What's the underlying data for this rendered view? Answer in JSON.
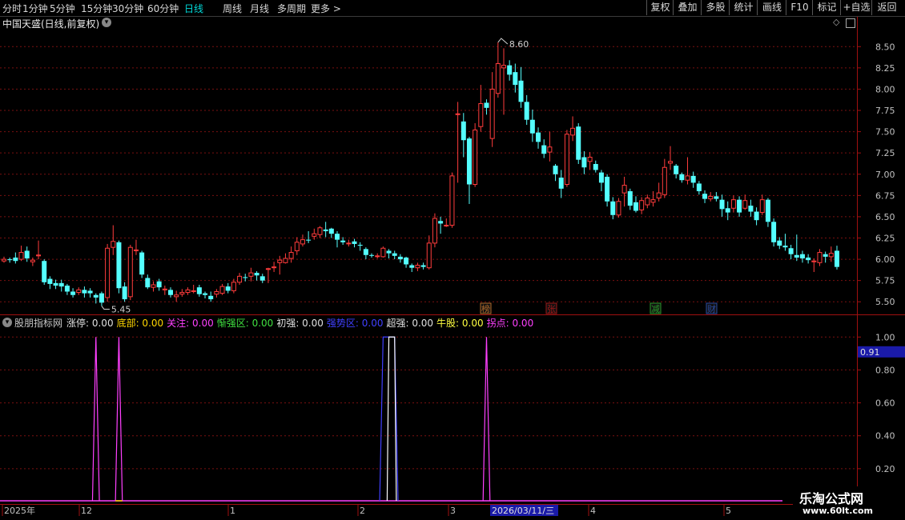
{
  "toolbar": {
    "periods": [
      "分时",
      "1分钟",
      "5分钟",
      "15分钟",
      "30分钟",
      "60分钟",
      "日线",
      "周线",
      "月线",
      "多周期",
      "更多 >"
    ],
    "active_period": "日线",
    "right_buttons": [
      "复权",
      "叠加",
      "多股",
      "统计",
      "画线",
      "F10",
      "标记",
      "+自选",
      "返回"
    ]
  },
  "main_chart": {
    "title": "中国天盛(日线,前复权)",
    "y_ticks": [
      "8.50",
      "8.25",
      "8.00",
      "7.75",
      "7.50",
      "7.25",
      "7.00",
      "6.75",
      "6.50",
      "6.25",
      "6.00",
      "5.75",
      "5.50"
    ],
    "high_label": "8.60",
    "low_label": "5.45",
    "event_badges": [
      {
        "label": "榜",
        "color": "#b06a2a"
      },
      {
        "label": "张",
        "color": "#a01818"
      },
      {
        "label": "减",
        "color": "#2a9a2a"
      },
      {
        "label": "财",
        "color": "#2a4aa0"
      }
    ]
  },
  "indicator": {
    "name": "股朋指标网",
    "items": [
      {
        "label": "涨停: 0.00",
        "color": "#e0e0e0"
      },
      {
        "label": "底部: 0.00",
        "color": "#ffd700"
      },
      {
        "label": "关注: 0.00",
        "color": "#ff40ff"
      },
      {
        "label": "惭强区: 0.00",
        "color": "#40e040"
      },
      {
        "label": "初强: 0.00",
        "color": "#e0e0e0"
      },
      {
        "label": "强势区: 0.00",
        "color": "#4040ff"
      },
      {
        "label": "超强: 0.00",
        "color": "#e0e0e0"
      },
      {
        "label": "牛股: 0.00",
        "color": "#ffff40"
      },
      {
        "label": "拐点: 0.00",
        "color": "#ff40ff"
      }
    ],
    "y_ticks": [
      "1.00",
      "0.80",
      "0.60",
      "0.40",
      "0.20"
    ],
    "current_value": "0.91"
  },
  "x_axis": {
    "labels": [
      "2025年",
      "12",
      "1",
      "2",
      "3",
      "4",
      "5"
    ],
    "highlight_date": "2026/03/11/三"
  },
  "watermark": {
    "line1": "乐淘公式网",
    "line2": "www.60lt.com"
  },
  "colors": {
    "up": "#ff3c3c",
    "down": "#54ffff",
    "grid": "#7a1010",
    "axis_text": "#c0c0c0"
  },
  "chart_data": {
    "type": "candlestick",
    "ylim": [
      5.38,
      8.7
    ],
    "indicator_ylim": [
      0,
      1.05
    ],
    "candles": [
      [
        5.98,
        6.0,
        5.96,
        6.03
      ],
      [
        6.0,
        5.99,
        5.96,
        6.02
      ],
      [
        6.02,
        5.98,
        5.95,
        6.08
      ],
      [
        6.0,
        6.08,
        5.98,
        6.16
      ],
      [
        6.1,
        6.01,
        5.97,
        6.15
      ],
      [
        5.97,
        5.99,
        5.92,
        6.02
      ],
      [
        6.04,
        6.05,
        6.0,
        6.22
      ],
      [
        5.98,
        5.73,
        5.7,
        6.0
      ],
      [
        5.77,
        5.71,
        5.65,
        5.8
      ],
      [
        5.72,
        5.69,
        5.65,
        5.76
      ],
      [
        5.72,
        5.68,
        5.62,
        5.76
      ],
      [
        5.69,
        5.62,
        5.58,
        5.71
      ],
      [
        5.62,
        5.58,
        5.55,
        5.66
      ],
      [
        5.61,
        5.64,
        5.58,
        5.67
      ],
      [
        5.64,
        5.6,
        5.55,
        5.68
      ],
      [
        5.63,
        5.6,
        5.55,
        5.66
      ],
      [
        5.58,
        5.55,
        5.48,
        5.6
      ],
      [
        5.6,
        5.49,
        5.45,
        5.62
      ],
      [
        5.55,
        6.13,
        5.5,
        6.18
      ],
      [
        6.14,
        6.21,
        6.05,
        6.4
      ],
      [
        6.2,
        5.66,
        5.6,
        6.22
      ],
      [
        5.68,
        5.53,
        5.5,
        5.73
      ],
      [
        5.56,
        6.14,
        5.52,
        6.17
      ],
      [
        6.1,
        6.11,
        6.05,
        6.23
      ],
      [
        6.08,
        5.82,
        5.78,
        6.1
      ],
      [
        5.78,
        5.67,
        5.65,
        5.82
      ],
      [
        5.67,
        5.7,
        5.62,
        5.74
      ],
      [
        5.74,
        5.67,
        5.63,
        5.77
      ],
      [
        5.64,
        5.65,
        5.58,
        5.69
      ],
      [
        5.64,
        5.58,
        5.55,
        5.67
      ],
      [
        5.56,
        5.58,
        5.5,
        5.63
      ],
      [
        5.59,
        5.61,
        5.56,
        5.65
      ],
      [
        5.61,
        5.64,
        5.58,
        5.67
      ],
      [
        5.62,
        5.63,
        5.6,
        5.7
      ],
      [
        5.67,
        5.59,
        5.56,
        5.7
      ],
      [
        5.6,
        5.58,
        5.54,
        5.62
      ],
      [
        5.57,
        5.53,
        5.5,
        5.62
      ],
      [
        5.59,
        5.62,
        5.55,
        5.65
      ],
      [
        5.6,
        5.68,
        5.58,
        5.71
      ],
      [
        5.68,
        5.63,
        5.6,
        5.72
      ],
      [
        5.63,
        5.73,
        5.6,
        5.77
      ],
      [
        5.73,
        5.8,
        5.7,
        5.84
      ],
      [
        5.79,
        5.78,
        5.74,
        5.83
      ],
      [
        5.8,
        5.84,
        5.74,
        5.9
      ],
      [
        5.84,
        5.81,
        5.75,
        5.86
      ],
      [
        5.8,
        5.75,
        5.72,
        5.83
      ],
      [
        5.88,
        5.89,
        5.72,
        5.9
      ],
      [
        5.9,
        5.91,
        5.85,
        5.97
      ],
      [
        5.96,
        5.99,
        5.82,
        6.04
      ],
      [
        5.96,
        6.01,
        5.95,
        6.07
      ],
      [
        6.01,
        6.08,
        5.96,
        6.15
      ],
      [
        6.1,
        6.2,
        6.05,
        6.26
      ],
      [
        6.18,
        6.23,
        6.15,
        6.29
      ],
      [
        6.23,
        6.22,
        6.19,
        6.33
      ],
      [
        6.27,
        6.3,
        6.23,
        6.36
      ],
      [
        6.29,
        6.37,
        6.25,
        6.39
      ],
      [
        6.35,
        6.33,
        6.26,
        6.44
      ],
      [
        6.36,
        6.3,
        6.25,
        6.37
      ],
      [
        6.3,
        6.23,
        6.14,
        6.33
      ],
      [
        6.22,
        6.2,
        6.17,
        6.26
      ],
      [
        6.19,
        6.19,
        6.15,
        6.23
      ],
      [
        6.21,
        6.18,
        6.14,
        6.24
      ],
      [
        6.17,
        6.16,
        6.1,
        6.2
      ],
      [
        6.12,
        6.05,
        6.0,
        6.14
      ],
      [
        6.05,
        6.04,
        6.02,
        6.07
      ],
      [
        6.04,
        6.04,
        6.01,
        6.07
      ],
      [
        6.03,
        6.13,
        6.02,
        6.15
      ],
      [
        6.1,
        6.07,
        6.01,
        6.12
      ],
      [
        6.07,
        6.04,
        6.0,
        6.1
      ],
      [
        6.03,
        6.0,
        5.96,
        6.06
      ],
      [
        6.02,
        5.94,
        5.9,
        6.03
      ],
      [
        5.93,
        5.9,
        5.85,
        5.95
      ],
      [
        5.9,
        5.93,
        5.86,
        5.96
      ],
      [
        5.93,
        5.91,
        5.88,
        5.96
      ],
      [
        5.9,
        6.19,
        5.88,
        6.28
      ],
      [
        6.19,
        6.48,
        6.14,
        6.54
      ],
      [
        6.45,
        6.42,
        6.3,
        6.5
      ],
      [
        6.4,
        6.4,
        6.38,
        6.48
      ],
      [
        6.4,
        6.98,
        6.37,
        7.02
      ],
      [
        7.71,
        7.71,
        6.9,
        7.85
      ],
      [
        7.62,
        7.4,
        7.2,
        7.72
      ],
      [
        7.42,
        6.88,
        6.65,
        7.44
      ],
      [
        6.88,
        7.52,
        6.85,
        7.6
      ],
      [
        7.56,
        7.83,
        7.5,
        8.05
      ],
      [
        7.84,
        7.78,
        7.7,
        7.88
      ],
      [
        7.42,
        8.0,
        7.32,
        8.2
      ],
      [
        7.95,
        8.3,
        7.9,
        8.55
      ],
      [
        8.25,
        8.28,
        7.7,
        8.48
      ],
      [
        8.28,
        8.17,
        8.1,
        8.34
      ],
      [
        8.2,
        8.05,
        7.96,
        8.3
      ],
      [
        8.1,
        7.85,
        7.78,
        8.26
      ],
      [
        7.85,
        7.64,
        7.58,
        7.93
      ],
      [
        7.64,
        7.48,
        7.38,
        7.76
      ],
      [
        7.49,
        7.38,
        7.3,
        7.55
      ],
      [
        7.34,
        7.24,
        7.19,
        7.41
      ],
      [
        7.26,
        7.32,
        7.15,
        7.5
      ],
      [
        7.1,
        7.0,
        6.92,
        7.12
      ],
      [
        6.96,
        6.83,
        6.72,
        7.05
      ],
      [
        6.88,
        7.47,
        6.85,
        7.52
      ],
      [
        7.46,
        7.54,
        7.39,
        7.68
      ],
      [
        7.56,
        7.17,
        7.12,
        7.6
      ],
      [
        7.2,
        7.08,
        7.0,
        7.27
      ],
      [
        7.15,
        7.2,
        7.05,
        7.26
      ],
      [
        7.12,
        7.05,
        7.02,
        7.16
      ],
      [
        7.02,
        6.9,
        6.8,
        7.05
      ],
      [
        6.97,
        6.68,
        6.62,
        7.0
      ],
      [
        6.68,
        6.52,
        6.47,
        6.73
      ],
      [
        6.52,
        6.68,
        6.49,
        6.72
      ],
      [
        6.78,
        6.87,
        6.62,
        6.97
      ],
      [
        6.8,
        6.63,
        6.58,
        6.83
      ],
      [
        6.67,
        6.57,
        6.55,
        6.74
      ],
      [
        6.58,
        6.69,
        6.53,
        6.73
      ],
      [
        6.64,
        6.72,
        6.6,
        6.76
      ],
      [
        6.67,
        6.7,
        6.62,
        6.8
      ],
      [
        6.72,
        6.78,
        6.68,
        6.9
      ],
      [
        6.76,
        7.08,
        6.72,
        7.18
      ],
      [
        7.13,
        7.15,
        7.05,
        7.33
      ],
      [
        7.1,
        7.0,
        6.95,
        7.12
      ],
      [
        7.0,
        6.93,
        6.9,
        7.02
      ],
      [
        6.93,
        6.98,
        6.88,
        7.2
      ],
      [
        6.98,
        6.9,
        6.84,
        7.03
      ],
      [
        6.89,
        6.8,
        6.76,
        6.92
      ],
      [
        6.77,
        6.71,
        6.66,
        6.81
      ],
      [
        6.71,
        6.74,
        6.68,
        6.79
      ],
      [
        6.74,
        6.71,
        6.68,
        6.79
      ],
      [
        6.7,
        6.59,
        6.5,
        6.76
      ],
      [
        6.6,
        6.55,
        6.46,
        6.68
      ],
      [
        6.6,
        6.7,
        6.55,
        6.75
      ],
      [
        6.7,
        6.55,
        6.5,
        6.74
      ],
      [
        6.6,
        6.69,
        6.58,
        6.76
      ],
      [
        6.63,
        6.56,
        6.5,
        6.7
      ],
      [
        6.56,
        6.46,
        6.4,
        6.61
      ],
      [
        6.55,
        6.7,
        6.52,
        6.76
      ],
      [
        6.7,
        6.44,
        6.38,
        6.72
      ],
      [
        6.44,
        6.2,
        6.15,
        6.48
      ],
      [
        6.22,
        6.16,
        6.12,
        6.26
      ],
      [
        6.16,
        6.14,
        6.1,
        6.3
      ],
      [
        6.13,
        6.06,
        6.0,
        6.17
      ],
      [
        6.05,
        6.02,
        5.98,
        6.29
      ],
      [
        6.06,
        6.01,
        5.96,
        6.1
      ],
      [
        6.02,
        5.99,
        5.95,
        6.06
      ],
      [
        5.97,
        5.98,
        5.85,
        6.01
      ],
      [
        5.96,
        6.08,
        5.92,
        6.12
      ],
      [
        6.06,
        6.03,
        5.96,
        6.09
      ],
      [
        6.03,
        6.07,
        5.97,
        6.15
      ],
      [
        6.1,
        5.91,
        5.88,
        6.16
      ]
    ],
    "indicator_series": [
      {
        "name": "关注",
        "color": "#ff40ff",
        "peaks": [
          [
            16,
            1
          ],
          [
            20,
            1
          ],
          [
            84,
            1
          ]
        ]
      },
      {
        "name": "强势区",
        "color": "#4040ff",
        "blocks": [
          [
            66,
            68
          ]
        ]
      },
      {
        "name": "超强",
        "color": "#ffffff",
        "blocks": [
          [
            67,
            68
          ]
        ]
      },
      {
        "name": "底部",
        "color": "#ffd700",
        "baseline": true
      }
    ]
  }
}
